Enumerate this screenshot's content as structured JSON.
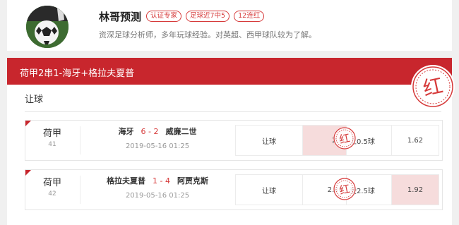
{
  "expert": {
    "name": "林哥预测",
    "tags": [
      "认证专家",
      "足球近7中5",
      "12连红"
    ],
    "bio": "资深足球分析师，多年玩球经验。对英超、西甲球队较为了解。"
  },
  "plan": {
    "title": "荷甲2串1-海牙+格拉夫夏普",
    "stamp": "红",
    "section": "让球"
  },
  "matches": [
    {
      "league": "荷甲",
      "league_no": "41",
      "home": "海牙",
      "score": "6 - 2",
      "away": "威廉二世",
      "time": "2019-05-16 01:25",
      "market": "让球",
      "odds_home": "2.6",
      "line": "上0.5球",
      "odds_away": "1.62",
      "pick": "home",
      "stamp": "红"
    },
    {
      "league": "荷甲",
      "league_no": "42",
      "home": "格拉夫夏普",
      "score": "1 - 4",
      "away": "阿贾克斯",
      "time": "2019-05-16 01:25",
      "market": "让球",
      "odds_home": "2.08",
      "line": "受2.5球",
      "odds_away": "1.92",
      "pick": "away",
      "stamp": "红"
    }
  ],
  "colors": {
    "accent": "#c8262d",
    "highlight": "#f6dcdc"
  }
}
